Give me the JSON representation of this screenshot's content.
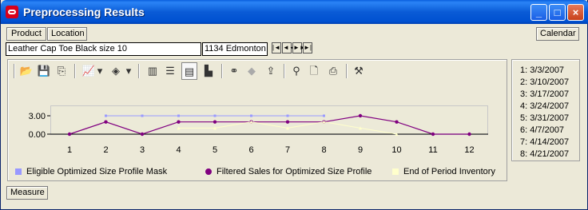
{
  "window": {
    "title": "Preprocessing Results",
    "minimize": "_",
    "maximize": "□",
    "close": "×"
  },
  "top_buttons": {
    "product": "Product",
    "location": "Location",
    "calendar": "Calendar"
  },
  "selection": {
    "product_value": "Leather Cap Toe Black size 10",
    "location_value": "1134 Edmonton"
  },
  "nav": [
    "|◄",
    "◄◄",
    "►►",
    "►|"
  ],
  "toolbar": [
    {
      "icon": "open-folder-icon",
      "glyph": "📂"
    },
    {
      "icon": "save-icon",
      "glyph": "💾"
    },
    {
      "icon": "copy-icon",
      "glyph": "⎘"
    },
    {
      "icon": "line-chart-icon",
      "glyph": "📈"
    },
    {
      "icon": "dropdown-arrow-icon",
      "glyph": "▾"
    },
    {
      "icon": "fill-color-icon",
      "glyph": "◈"
    },
    {
      "icon": "dropdown-arrow-icon",
      "glyph": "▾"
    },
    {
      "icon": "vertical-grid-icon",
      "glyph": "▥"
    },
    {
      "icon": "horizontal-grid-icon",
      "glyph": "☰"
    },
    {
      "icon": "legend-icon",
      "glyph": "▤"
    },
    {
      "icon": "chart-wizard-icon",
      "glyph": "▙"
    },
    {
      "icon": "binoculars-icon",
      "glyph": "⚭"
    },
    {
      "icon": "diamond-icon",
      "glyph": "◆"
    },
    {
      "icon": "export-icon",
      "glyph": "⇪"
    },
    {
      "icon": "zoom-icon",
      "glyph": "⚲"
    },
    {
      "icon": "print-preview-icon",
      "glyph": "🗋"
    },
    {
      "icon": "print-icon",
      "glyph": "⎙"
    },
    {
      "icon": "hammer-icon",
      "glyph": "⚒"
    }
  ],
  "chart_data": {
    "type": "line",
    "x": [
      1,
      2,
      3,
      4,
      5,
      6,
      7,
      8,
      9,
      10,
      11,
      12
    ],
    "x_tick_labels": [
      "1",
      "2",
      "3",
      "4",
      "5",
      "6",
      "7",
      "8",
      "9",
      "10",
      "11",
      "12"
    ],
    "y_tick_labels": [
      "3.00",
      "0.00"
    ],
    "y_ticks": [
      3,
      0
    ],
    "ylim": [
      0,
      3
    ],
    "series": [
      {
        "name": "Eligible Optimized Size Profile Mask",
        "color": "#9999ff",
        "marker": "square",
        "values": [
          null,
          3,
          3,
          3,
          3,
          3,
          3,
          3,
          null,
          null,
          null,
          null
        ]
      },
      {
        "name": "Filtered Sales for Optimized Size Profile",
        "color": "#800080",
        "marker": "circle",
        "values": [
          0,
          2,
          0,
          2,
          2,
          2,
          2,
          2,
          3,
          2,
          0,
          0
        ]
      },
      {
        "name": "End of Period Inventory",
        "color": "#ffffcc",
        "marker": "triangle",
        "values": [
          null,
          null,
          null,
          1,
          1,
          2,
          1,
          2,
          1,
          0,
          null,
          null
        ]
      }
    ],
    "grid": false,
    "legend": "bottom"
  },
  "calendar_list": [
    "1:  3/3/2007",
    "2:  3/10/2007",
    "3:  3/17/2007",
    "4:  3/24/2007",
    "5:  3/31/2007",
    "6:  4/7/2007",
    "7:  4/14/2007",
    "8:  4/21/2007"
  ],
  "bottom": {
    "measure": "Measure"
  }
}
